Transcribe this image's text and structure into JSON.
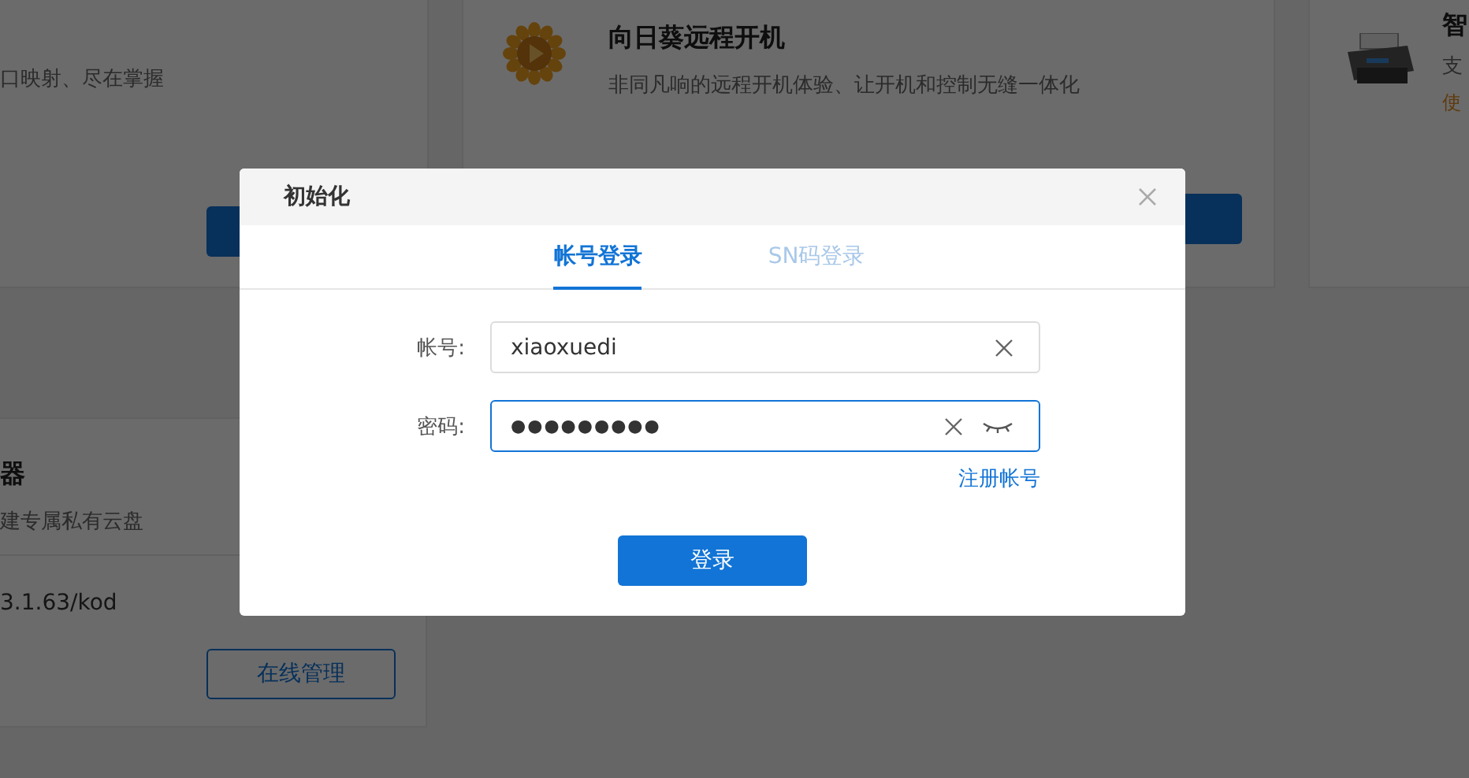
{
  "page": {
    "top_cards": [
      {
        "kind": "cut_left",
        "description": "口映射、尽在掌握"
      },
      {
        "kind": "full",
        "title": "向日葵远程开机",
        "description": "非同凡响的远程开机体验、让开机和控制无缝一体化"
      },
      {
        "kind": "cut_right",
        "title": "智",
        "description": "支",
        "note": "使"
      }
    ],
    "bottom_card": {
      "title": "器",
      "description": "建专属私有云盘",
      "address": "3.1.63/kod",
      "button": "在线管理"
    }
  },
  "dialog": {
    "title": "初始化",
    "tabs": [
      {
        "label": "帐号登录",
        "selected": true
      },
      {
        "label": "SN码登录",
        "selected": false
      }
    ],
    "fields": [
      {
        "kind": "text",
        "label": "帐号:",
        "value": "xiaoxuedi",
        "focused": false
      },
      {
        "kind": "password",
        "label": "密码:",
        "value": "●●●●●●●●●",
        "focused": true
      }
    ],
    "register_link": "注册帐号",
    "submit": "登录"
  }
}
